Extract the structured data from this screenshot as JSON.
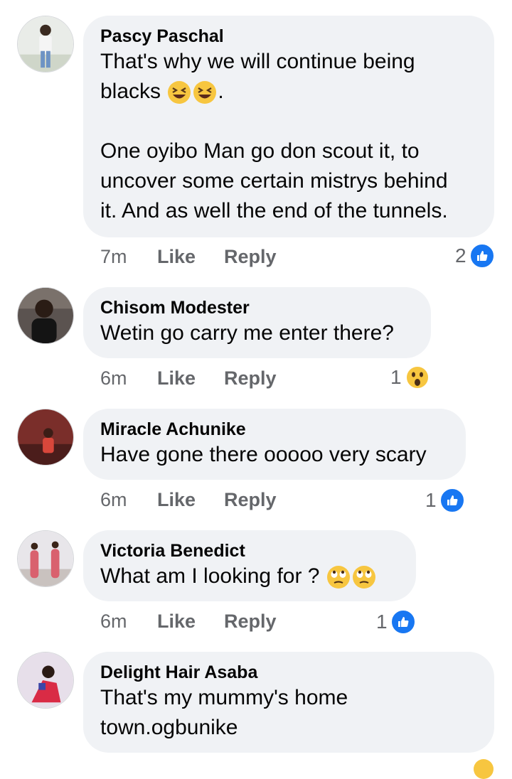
{
  "comments": [
    {
      "name": "Pascy Paschal",
      "text_line1": "That's why we will continue being",
      "text_line2": "blacks",
      "text_line2_suffix": ".",
      "text_rest": "One oyibo Man go don scout it, to\nuncover some certain mistrys behind\nit. And as well the end of the tunnels.",
      "time": "7m",
      "like": "Like",
      "reply": "Reply",
      "reaction_count": "2",
      "reaction_icon": "like-icon"
    },
    {
      "name": "Chisom Modester",
      "text": "Wetin go carry me enter there?",
      "time": "6m",
      "like": "Like",
      "reply": "Reply",
      "reaction_count": "1",
      "reaction_icon": "wow-icon"
    },
    {
      "name": "Miracle Achunike",
      "text": "Have gone there ooooo very scary",
      "time": "6m",
      "like": "Like",
      "reply": "Reply",
      "reaction_count": "1",
      "reaction_icon": "like-icon"
    },
    {
      "name": "Victoria Benedict",
      "text": "What am I looking for ?",
      "time": "6m",
      "like": "Like",
      "reply": "Reply",
      "reaction_count": "1",
      "reaction_icon": "like-icon"
    },
    {
      "name": "Delight Hair Asaba",
      "text": "That's my mummy's home\ntown.ogbunike"
    }
  ],
  "colors": {
    "bubble": "#f0f2f5",
    "like_blue": "#1877f2",
    "meta_gray": "#65676b"
  }
}
